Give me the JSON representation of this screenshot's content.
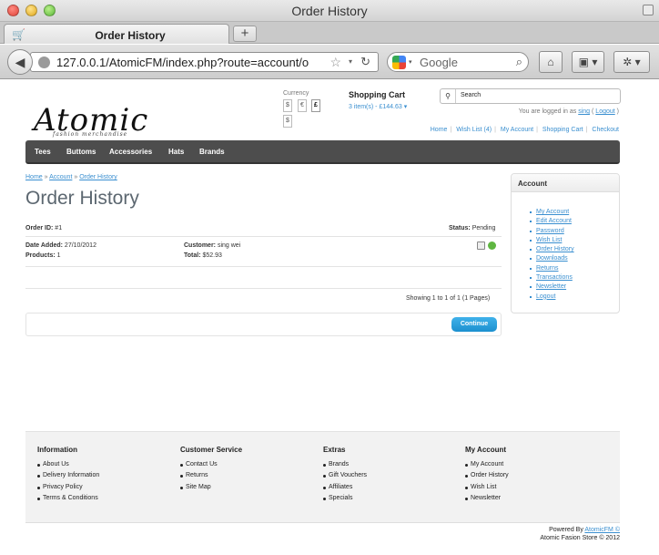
{
  "browser": {
    "window_title": "Order History",
    "tab_title": "Order History",
    "new_tab_label": "+",
    "url": "127.0.0.1/AtomicFM/index.php?route=account/o",
    "search_engine": "Google"
  },
  "header": {
    "logo_text": "Atomic",
    "logo_tagline": "fashion merchandise",
    "currency_label": "Currency",
    "currencies": [
      "$",
      "€",
      "£",
      "$"
    ],
    "cart_title": "Shopping Cart",
    "cart_items": "3 item(s) - £144.63",
    "search_placeholder": "Search",
    "logged_in_prefix": "You are logged in as",
    "logged_in_user": "sing",
    "logout_label": "Logout",
    "top_links": [
      "Home",
      "Wish List (4)",
      "My Account",
      "Shopping Cart",
      "Checkout"
    ]
  },
  "menu": [
    "Tees",
    "Buttoms",
    "Accessories",
    "Hats",
    "Brands"
  ],
  "breadcrumb": [
    "Home",
    "Account",
    "Order History"
  ],
  "heading": "Order History",
  "order": {
    "id_label": "Order ID:",
    "id_value": "#1",
    "status_label": "Status:",
    "status_value": "Pending",
    "date_label": "Date Added:",
    "date_value": "27/10/2012",
    "products_label": "Products:",
    "products_value": "1",
    "customer_label": "Customer:",
    "customer_value": "sing wei",
    "total_label": "Total:",
    "total_value": "$52.93"
  },
  "pagination": "Showing 1 to 1 of 1 (1 Pages)",
  "continue_label": "Continue",
  "sidebar": {
    "title": "Account",
    "links": [
      "My Account",
      "Edit Account",
      "Password",
      "Wish List",
      "Order History",
      "Downloads",
      "Returns",
      "Transactions",
      "Newsletter",
      "Logout"
    ]
  },
  "footer": {
    "columns": [
      {
        "title": "Information",
        "items": [
          "About Us",
          "Delivery Information",
          "Privacy Policy",
          "Terms & Conditions"
        ]
      },
      {
        "title": "Customer Service",
        "items": [
          "Contact Us",
          "Returns",
          "Site Map"
        ]
      },
      {
        "title": "Extras",
        "items": [
          "Brands",
          "Gift Vouchers",
          "Affiliates",
          "Specials"
        ]
      },
      {
        "title": "My Account",
        "items": [
          "My Account",
          "Order History",
          "Wish List",
          "Newsletter"
        ]
      }
    ],
    "powered_by_prefix": "Powered By",
    "powered_by_link": "AtomicFM ©",
    "copyright": "Atomic Fasion Store © 2012"
  }
}
